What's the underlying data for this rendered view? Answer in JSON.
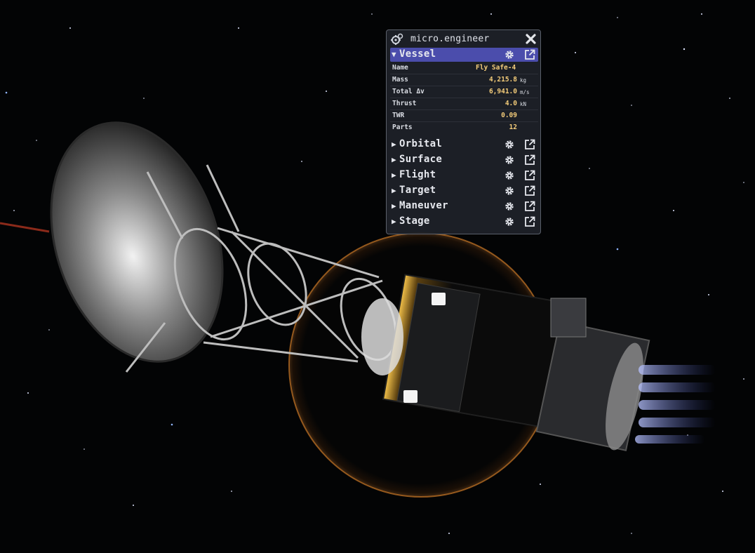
{
  "window": {
    "title": "micro.engineer",
    "icons": {
      "logo": "gears-icon",
      "close": "close-icon"
    }
  },
  "vessel_section": {
    "label": "Vessel",
    "expanded": true,
    "rows": [
      {
        "name": "Name",
        "value": "Fly Safe-4",
        "unit": ""
      },
      {
        "name": "Mass",
        "value": "4,215.8",
        "unit": "kg"
      },
      {
        "name": "Total Δv",
        "value": "6,941.0",
        "unit": "m/s"
      },
      {
        "name": "Thrust",
        "value": "4.0",
        "unit": "kN"
      },
      {
        "name": "TWR",
        "value": "0.09",
        "unit": ""
      },
      {
        "name": "Parts",
        "value": "12",
        "unit": ""
      }
    ]
  },
  "collapsed_sections": [
    {
      "label": "Orbital"
    },
    {
      "label": "Surface"
    },
    {
      "label": "Flight"
    },
    {
      "label": "Target"
    },
    {
      "label": "Maneuver"
    },
    {
      "label": "Stage"
    }
  ],
  "colors": {
    "window_bg": "#1e2128",
    "active_header": "#4b4dac",
    "value_text": "#f4cc7a",
    "label_text": "#e6e8ee"
  }
}
